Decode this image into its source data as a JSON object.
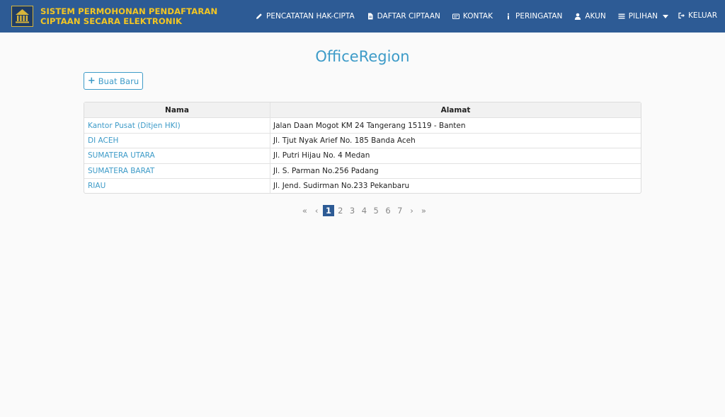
{
  "brand": {
    "line1": "SISTEM PERMOHONAN PENDAFTARAN",
    "line2": "CIPTAAN SECARA ELEKTRONIK"
  },
  "nav": {
    "items": [
      {
        "label": "PENCATATAN HAK-CIPTA",
        "icon": "pencil-icon"
      },
      {
        "label": "DAFTAR CIPTAAN",
        "icon": "file-icon"
      },
      {
        "label": "KONTAK",
        "icon": "card-icon"
      },
      {
        "label": "PERINGATAN",
        "icon": "info-icon"
      },
      {
        "label": "AKUN",
        "icon": "user-icon"
      },
      {
        "label": "PILIHAN",
        "icon": "menu-icon"
      }
    ],
    "logout": "KELUAR"
  },
  "page": {
    "title": "OfficeRegion",
    "new_button": "Buat Baru"
  },
  "table": {
    "headers": [
      "Nama",
      "Alamat"
    ],
    "rows": [
      {
        "nama": "Kantor Pusat (Ditjen HKI)",
        "alamat": "Jalan Daan Mogot KM 24 Tangerang 15119 - Banten"
      },
      {
        "nama": "DI ACEH",
        "alamat": "Jl. Tjut Nyak Arief No. 185 Banda Aceh"
      },
      {
        "nama": "SUMATERA UTARA",
        "alamat": "Jl. Putri Hijau No. 4 Medan"
      },
      {
        "nama": "SUMATERA BARAT",
        "alamat": "Jl. S. Parman No.256 Padang"
      },
      {
        "nama": "RIAU",
        "alamat": "Jl. Jend. Sudirman No.233 Pekanbaru"
      }
    ]
  },
  "pagination": {
    "first": "«",
    "prev": "‹",
    "pages": [
      "1",
      "2",
      "3",
      "4",
      "5",
      "6",
      "7"
    ],
    "current": "1",
    "next": "›",
    "last": "»"
  },
  "colors": {
    "navbar": "#2d5b95",
    "brand_text": "#f3c623",
    "accent": "#3d9bc8"
  }
}
